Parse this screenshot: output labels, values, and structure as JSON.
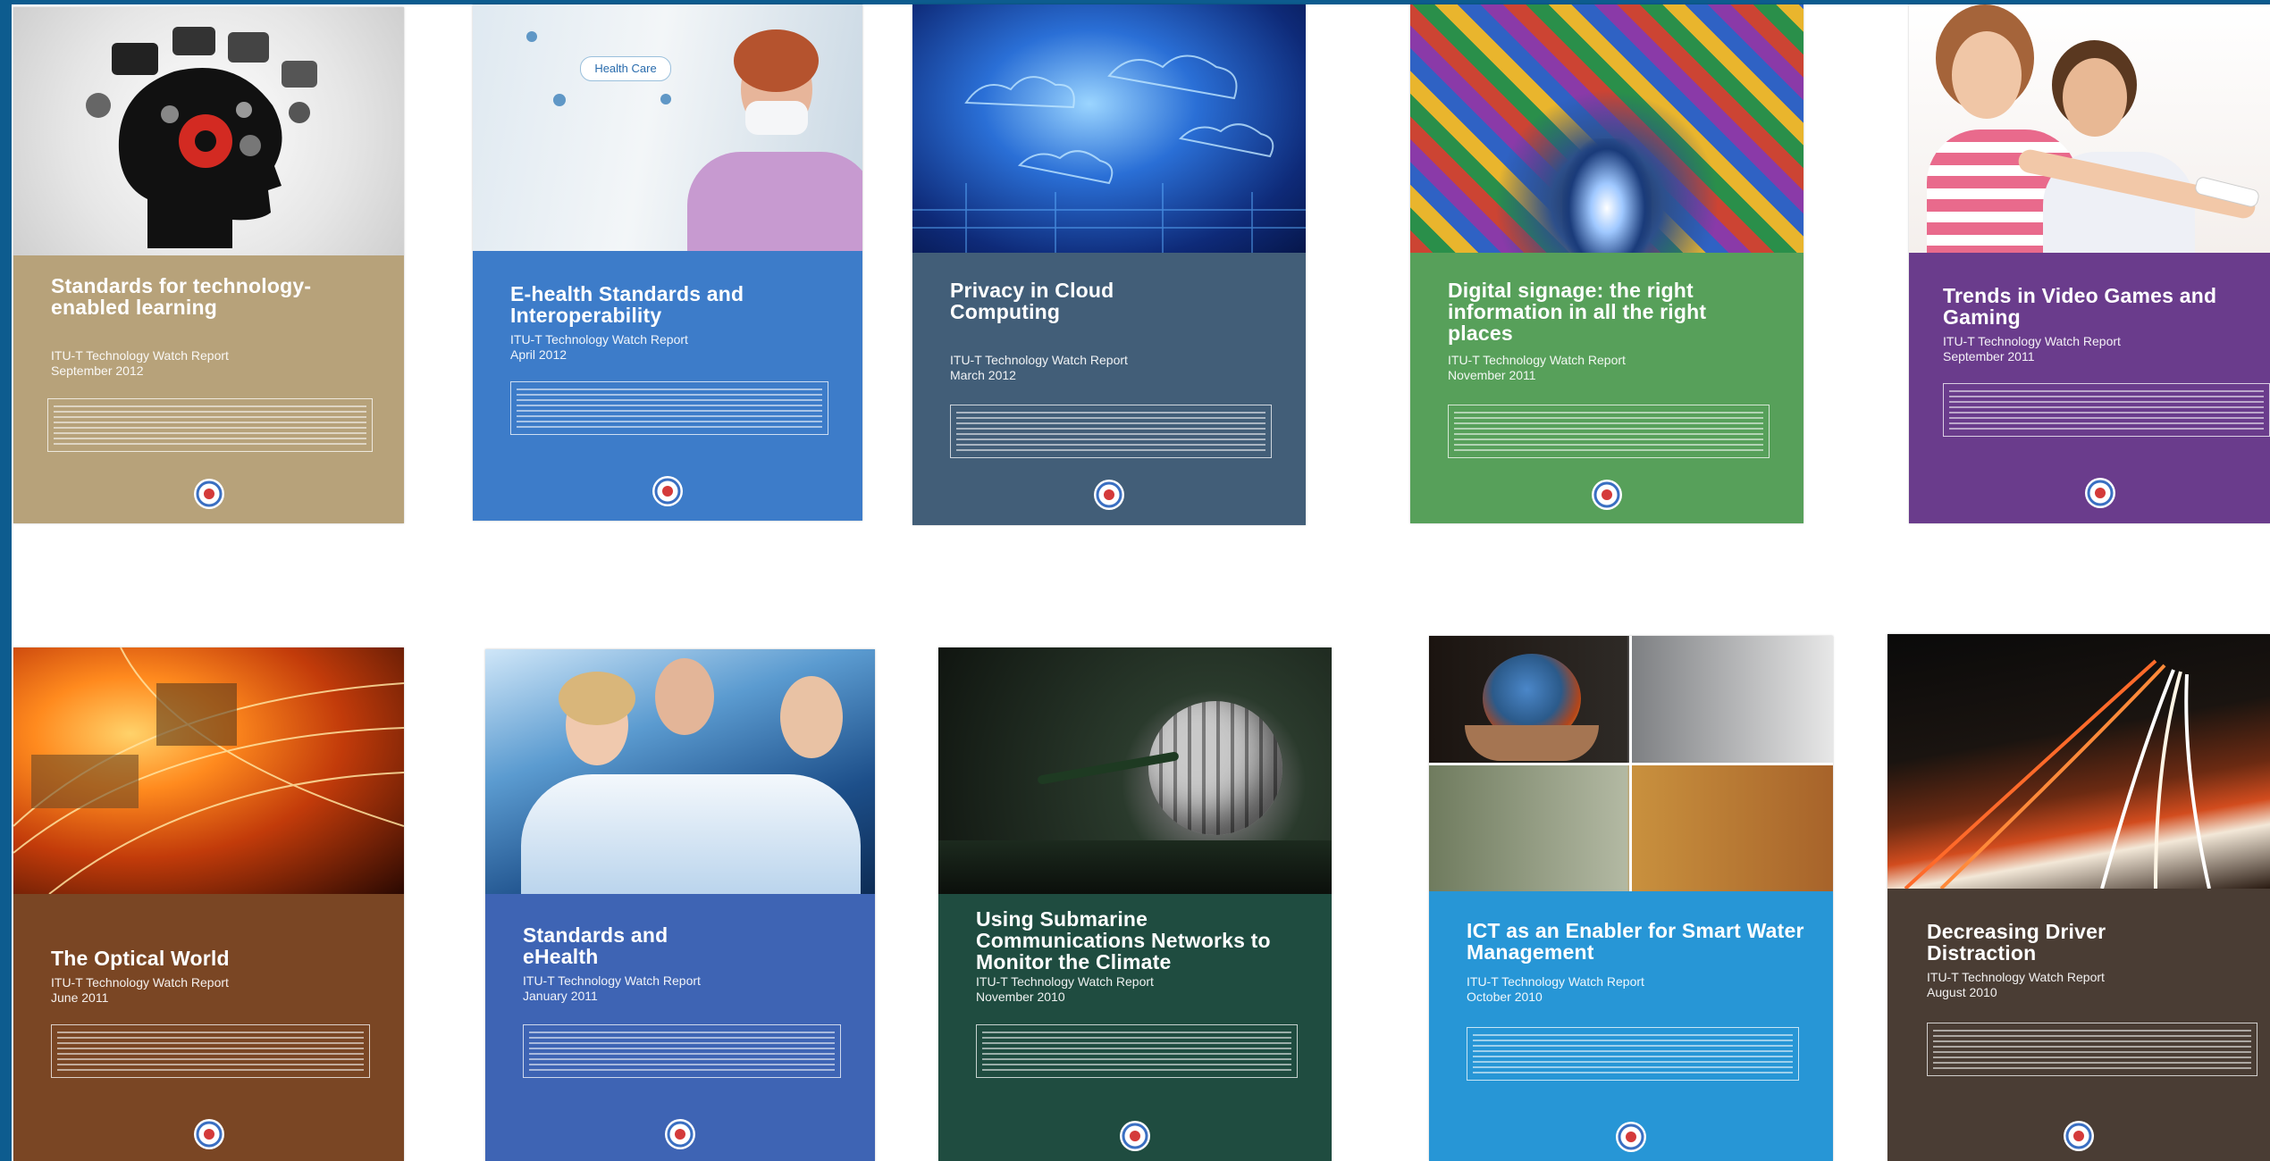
{
  "covers": [
    {
      "title": "Standards for technology-enabled learning",
      "series": "ITU-T Technology Watch Report",
      "date": "September 2012",
      "panel_color": "#b7a27a"
    },
    {
      "title": "E-health Standards and Interoperability",
      "series": "ITU-T Technology Watch Report",
      "date": "April 2012",
      "badge": "Health Care",
      "panel_color": "#3d7cc9"
    },
    {
      "title": "Privacy in Cloud Computing",
      "series": "ITU-T Technology Watch Report",
      "date": "March 2012",
      "panel_color": "#425e78"
    },
    {
      "title": "Digital signage: the right information in all the right places",
      "series": "ITU-T Technology Watch Report",
      "date": "November 2011",
      "panel_color": "#57a05a"
    },
    {
      "title": "Trends in Video Games and Gaming",
      "series": "ITU-T Technology Watch Report",
      "date": "September 2011",
      "panel_color": "#6a3c8c"
    },
    {
      "title": "The Optical World",
      "series": "ITU-T Technology Watch Report",
      "date": "June 2011",
      "panel_color": "#7a4624"
    },
    {
      "title": "Standards and eHealth",
      "series": "ITU-T Technology Watch Report",
      "date": "January 2011",
      "panel_color": "#3e64b4"
    },
    {
      "title": "Using Submarine Communications Networks to Monitor the Climate",
      "series": "ITU-T Technology Watch Report",
      "date": "November 2010",
      "panel_color": "#1f4c40"
    },
    {
      "title": "ICT as an Enabler for Smart Water Management",
      "series": "ITU-T Technology Watch Report",
      "date": "October 2010",
      "panel_color": "#2796d6"
    },
    {
      "title": "Decreasing Driver Distraction",
      "series": "ITU-T Technology Watch Report",
      "date": "August 2010",
      "panel_color": "#4a3d34"
    }
  ],
  "logo": "itu-logo-icon"
}
